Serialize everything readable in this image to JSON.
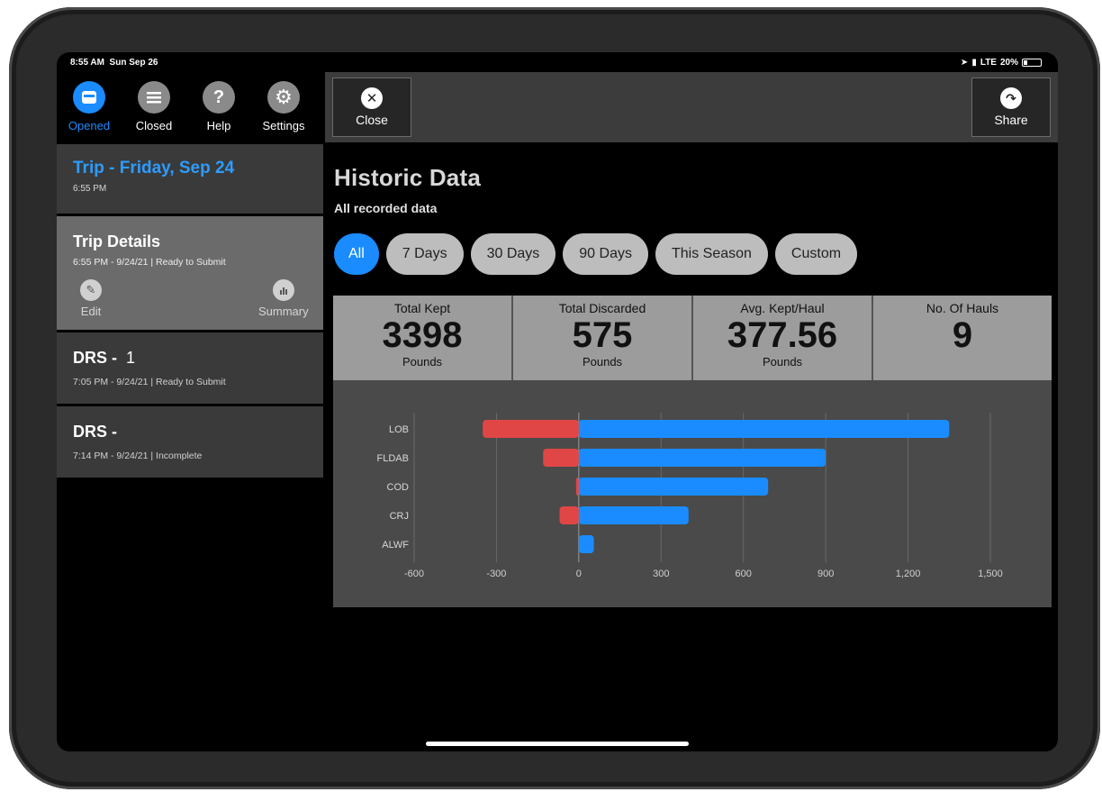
{
  "status_bar": {
    "time": "8:55 AM",
    "date": "Sun Sep 26",
    "signal": "LTE",
    "battery_text": "20%",
    "battery_level": 0.2
  },
  "toolbar": [
    {
      "label": "Opened",
      "icon": "inbox-icon"
    },
    {
      "label": "Closed",
      "icon": "list-icon"
    },
    {
      "label": "Help",
      "icon": "help-icon"
    },
    {
      "label": "Settings",
      "icon": "gear-icon"
    }
  ],
  "sidebar": {
    "trip": {
      "title": "Trip - Friday, Sep 24",
      "time": "6:55 PM"
    },
    "trip_details": {
      "title": "Trip Details",
      "subtitle": "6:55 PM - 9/24/21 | Ready to Submit",
      "edit_label": "Edit",
      "summary_label": "Summary"
    },
    "drs": [
      {
        "title": "DRS -",
        "number": "1",
        "subtitle": "7:05 PM - 9/24/21  |  Ready to Submit"
      },
      {
        "title": "DRS -",
        "number": "",
        "subtitle": "7:14 PM - 9/24/21  |  Incomplete"
      }
    ]
  },
  "topbar": {
    "close_label": "Close",
    "share_label": "Share"
  },
  "main": {
    "title": "Historic Data",
    "subtitle": "All recorded data",
    "filters": [
      "All",
      "7 Days",
      "30 Days",
      "90 Days",
      "This Season",
      "Custom"
    ],
    "active_filter": "All",
    "stats": [
      {
        "label": "Total Kept",
        "value": "3398",
        "unit": "Pounds"
      },
      {
        "label": "Total Discarded",
        "value": "575",
        "unit": "Pounds"
      },
      {
        "label": "Avg. Kept/Haul",
        "value": "377.56",
        "unit": "Pounds"
      },
      {
        "label": "No. Of Hauls",
        "value": "9",
        "unit": ""
      }
    ]
  },
  "chart_data": {
    "type": "bar",
    "orientation": "horizontal",
    "categories": [
      "LOB",
      "FLDAB",
      "COD",
      "CRJ",
      "ALWF"
    ],
    "series": [
      {
        "values": [
          1350,
          900,
          690,
          400,
          55
        ],
        "color": "#1a8cff"
      },
      {
        "values": [
          -350,
          -130,
          -10,
          -70,
          0
        ],
        "color": "#e04646"
      }
    ],
    "xlim": [
      -600,
      1500
    ],
    "xticks": [
      -600,
      -300,
      0,
      300,
      600,
      900,
      1200,
      1500
    ],
    "xtick_labels": [
      "-600",
      "-300",
      "0",
      "300",
      "600",
      "900",
      "1,200",
      "1,500"
    ],
    "grid": true
  },
  "colors": {
    "accent": "#1a8cff",
    "discard": "#e04646"
  }
}
